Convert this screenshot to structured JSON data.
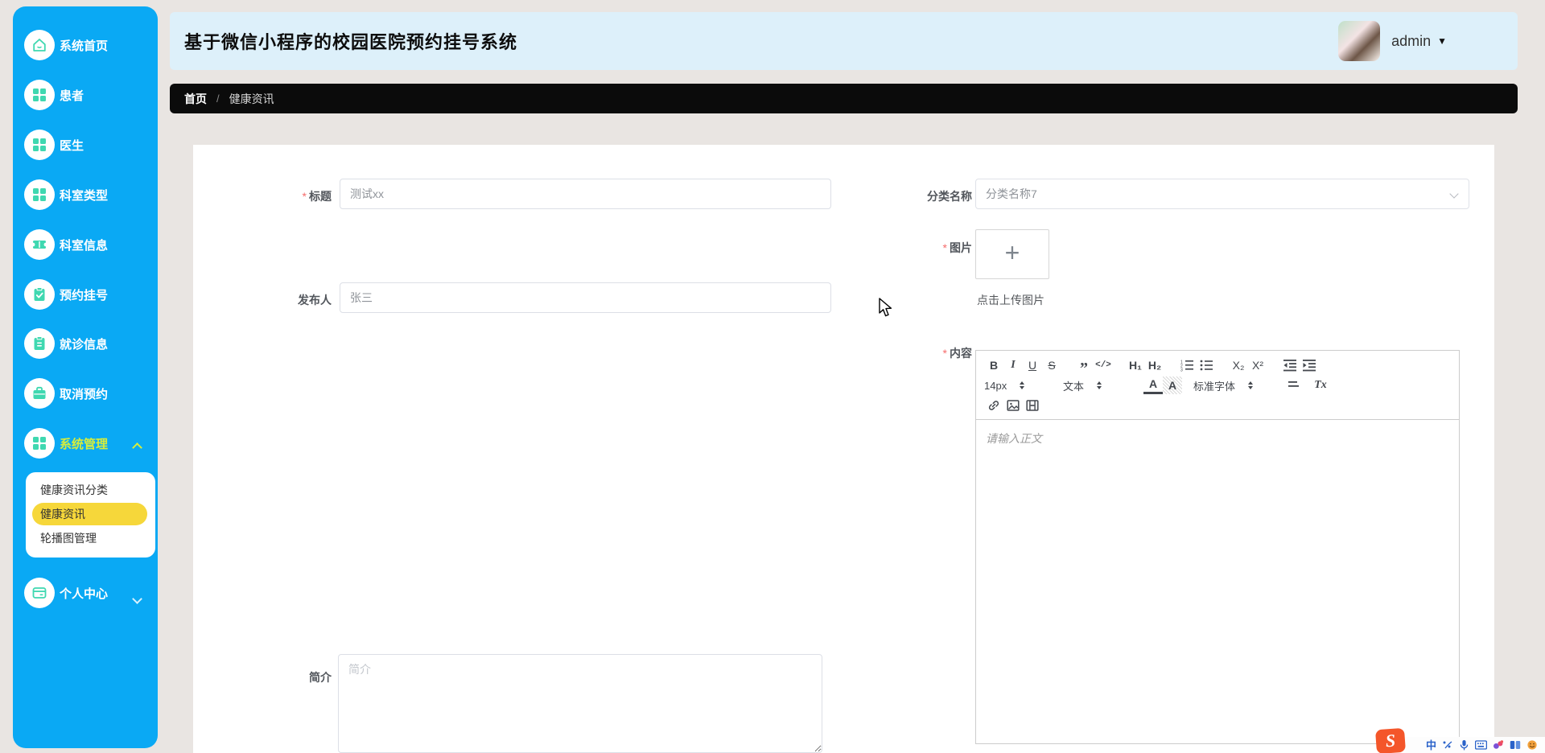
{
  "app": {
    "title": "基于微信小程序的校园医院预约挂号系统",
    "user": "admin",
    "dropdown_arrow": "▼"
  },
  "breadcrumb": {
    "home": "首页",
    "separator": "/",
    "current": "健康资讯"
  },
  "sidebar": {
    "items": [
      {
        "label": "系统首页"
      },
      {
        "label": "患者"
      },
      {
        "label": "医生"
      },
      {
        "label": "科室类型"
      },
      {
        "label": "科室信息"
      },
      {
        "label": "预约挂号"
      },
      {
        "label": "就诊信息"
      },
      {
        "label": "取消预约"
      },
      {
        "label": "系统管理"
      },
      {
        "label": "个人中心"
      }
    ],
    "submenu": {
      "items": [
        {
          "label": "健康资讯分类"
        },
        {
          "label": "健康资讯"
        },
        {
          "label": "轮播图管理"
        }
      ],
      "selected": "健康资讯"
    }
  },
  "form": {
    "title": {
      "label": "标题",
      "required_mark": "*",
      "value": "测试xx"
    },
    "category": {
      "label": "分类名称",
      "value": "分类名称7"
    },
    "publisher": {
      "label": "发布人",
      "value": "张三"
    },
    "image": {
      "label": "图片",
      "required_mark": "*",
      "plus": "+",
      "hint": "点击上传图片"
    },
    "content": {
      "label": "内容",
      "required_mark": "*",
      "placeholder": "请输入正文",
      "toolbar": {
        "bold": "B",
        "italic": "I",
        "underline": "U",
        "strike": "S",
        "quote": "”",
        "code": "</>",
        "h1": "H₁",
        "h2": "H₂",
        "sub": "X₂",
        "sup": "X²",
        "size": "14px",
        "text_style": "文本",
        "color": "A",
        "background": "A",
        "font": "标准字体",
        "clear": "Tx"
      }
    },
    "intro": {
      "label": "简介",
      "placeholder": "简介"
    }
  },
  "ime": {
    "logo": "S",
    "chinese_mode": "中"
  }
}
